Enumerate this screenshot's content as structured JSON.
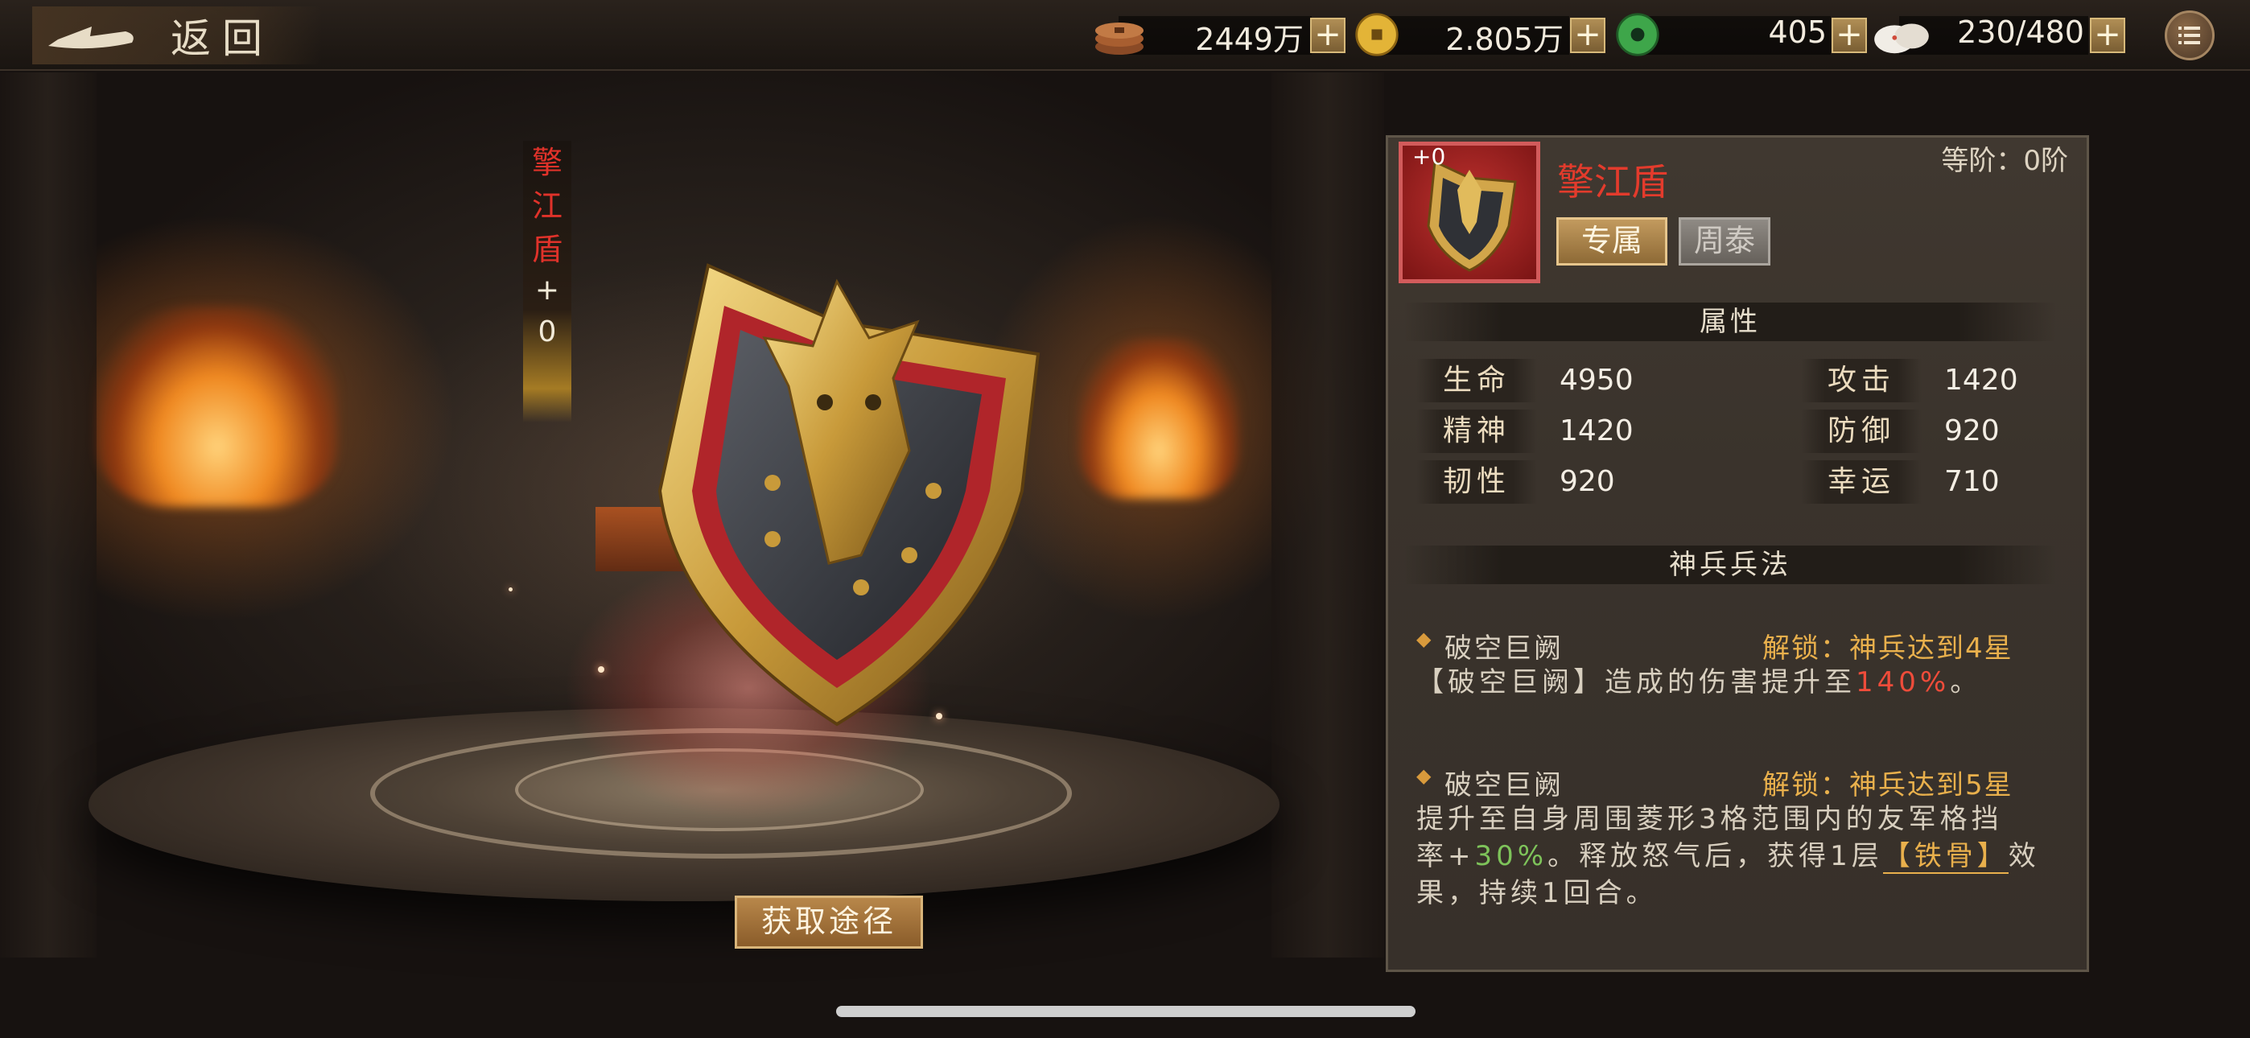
{
  "topbar": {
    "back_label": "返回",
    "resources": [
      {
        "icon": "copper-coins-icon",
        "value": "2449万"
      },
      {
        "icon": "gold-coin-icon",
        "value": "2.805万"
      },
      {
        "icon": "jade-icon",
        "value": "405"
      },
      {
        "icon": "steamed-bun-icon",
        "value": "230/480"
      }
    ],
    "plus": "+"
  },
  "equipment": {
    "name": "擎江盾",
    "name_chars": [
      "擎",
      "江",
      "盾"
    ],
    "plus_sign": "+",
    "level": "0",
    "icon_level": "+0",
    "grade_label": "等阶：0阶",
    "tag_exclusive": "专属",
    "tag_hero": "周泰",
    "obtain_button": "获取途径"
  },
  "attributes": {
    "title": "属性",
    "items": [
      {
        "label": "生命",
        "value": "4950"
      },
      {
        "label": "攻击",
        "value": "1420"
      },
      {
        "label": "精神",
        "value": "1420"
      },
      {
        "label": "防御",
        "value": "920"
      },
      {
        "label": "韧性",
        "value": "920"
      },
      {
        "label": "幸运",
        "value": "710"
      }
    ]
  },
  "skills": {
    "title": "神兵兵法",
    "entries": [
      {
        "name": "破空巨阙",
        "unlock": "解锁：神兵达到4星",
        "desc_line1_a": "【破空巨阙】造成的伤害提升至",
        "desc_line1_highlight": "140%",
        "desc_line1_b": "。"
      },
      {
        "name": "破空巨阙",
        "unlock": "解锁：神兵达到5星",
        "desc_line1": "提升至自身周围菱形3格范围内的友军格挡",
        "desc_line2_a": "率+",
        "desc_line2_highlight": "30%",
        "desc_line2_b": "。释放怒气后，获得1层",
        "desc_line2_buff": "【铁骨】",
        "desc_line2_c": "效",
        "desc_line3": "果，持续1回合。"
      }
    ]
  },
  "colors": {
    "name_red": "#e33b2c",
    "unlock_gold": "#e9b04c",
    "value_red": "#ef4c3a",
    "value_green": "#7ec35a"
  }
}
